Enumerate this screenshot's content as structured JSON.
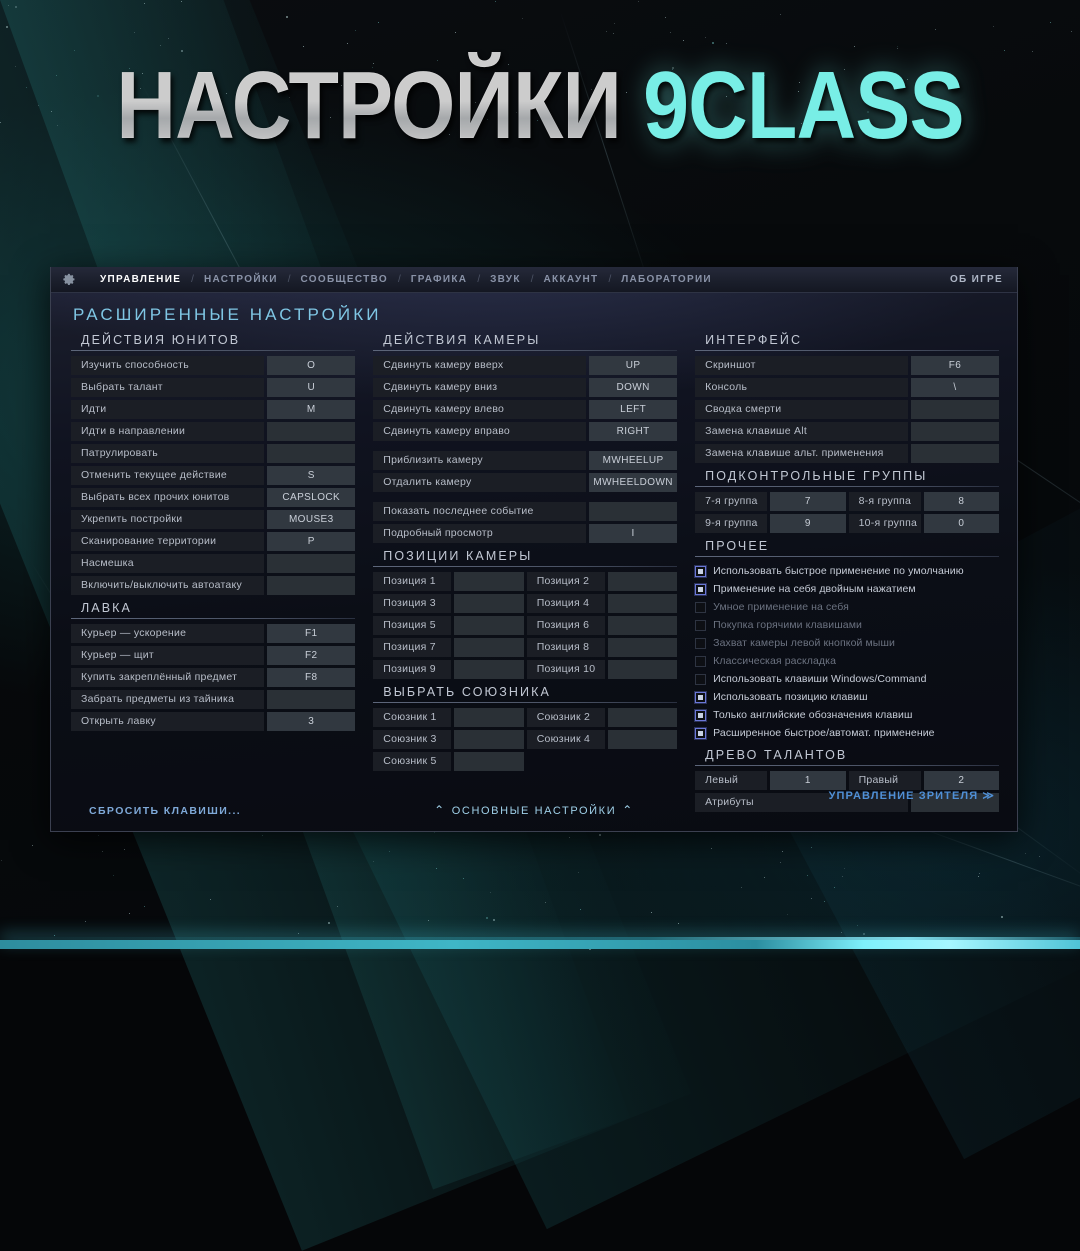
{
  "hero": {
    "title_white": "НАСТРОЙКИ",
    "title_cyan": "9CLASS",
    "cyan": "#78eee6"
  },
  "tabs": {
    "gear_icon": "gear-icon",
    "items": [
      {
        "label": "УПРАВЛЕНИЕ",
        "active": true
      },
      {
        "label": "НАСТРОЙКИ",
        "active": false
      },
      {
        "label": "СООБЩЕСТВО",
        "active": false
      },
      {
        "label": "ГРАФИКА",
        "active": false
      },
      {
        "label": "ЗВУК",
        "active": false
      },
      {
        "label": "АККАУНТ",
        "active": false
      },
      {
        "label": "ЛАБОРАТОРИИ",
        "active": false
      }
    ],
    "separator": "/",
    "right_item": "ОБ ИГРЕ"
  },
  "page_title": "РАСШИРЕННЫЕ НАСТРОЙКИ",
  "columns": {
    "unit_actions": {
      "heading": "ДЕЙСТВИЯ ЮНИТОВ",
      "rows": [
        {
          "label": "Изучить способность",
          "key": "O"
        },
        {
          "label": "Выбрать талант",
          "key": "U"
        },
        {
          "label": "Идти",
          "key": "M"
        },
        {
          "label": "Идти в направлении",
          "key": ""
        },
        {
          "label": "Патрулировать",
          "key": ""
        },
        {
          "label": "Отменить текущее действие",
          "key": "S"
        },
        {
          "label": "Выбрать всех прочих юнитов",
          "key": "CAPSLOCK"
        },
        {
          "label": "Укрепить постройки",
          "key": "MOUSE3"
        },
        {
          "label": "Сканирование территории",
          "key": "P"
        },
        {
          "label": "Насмешка",
          "key": ""
        },
        {
          "label": "Включить/выключить автоатаку",
          "key": ""
        }
      ]
    },
    "shop": {
      "heading": "ЛАВКА",
      "rows": [
        {
          "label": "Курьер — ускорение",
          "key": "F1"
        },
        {
          "label": "Курьер — щит",
          "key": "F2"
        },
        {
          "label": "Купить закреплённый предмет",
          "key": "F8"
        },
        {
          "label": "Забрать предметы из тайника",
          "key": ""
        },
        {
          "label": "Открыть лавку",
          "key": "3"
        }
      ]
    },
    "camera_actions": {
      "heading": "ДЕЙСТВИЯ КАМЕРЫ",
      "rows": [
        {
          "label": "Сдвинуть камеру вверх",
          "key": "UP"
        },
        {
          "label": "Сдвинуть камеру вниз",
          "key": "DOWN"
        },
        {
          "label": "Сдвинуть камеру влево",
          "key": "LEFT"
        },
        {
          "label": "Сдвинуть камеру вправо",
          "key": "RIGHT"
        }
      ],
      "rows2": [
        {
          "label": "Приблизить камеру",
          "key": "MWHEELUP"
        },
        {
          "label": "Отдалить камеру",
          "key": "MWHEELDOWN"
        }
      ],
      "rows3": [
        {
          "label": "Показать последнее событие",
          "key": ""
        },
        {
          "label": "Подробный просмотр",
          "key": "I"
        }
      ]
    },
    "camera_positions": {
      "heading": "ПОЗИЦИИ КАМЕРЫ",
      "rows": [
        [
          {
            "label": "Позиция 1",
            "key": ""
          },
          {
            "label": "Позиция 2",
            "key": ""
          }
        ],
        [
          {
            "label": "Позиция 3",
            "key": ""
          },
          {
            "label": "Позиция 4",
            "key": ""
          }
        ],
        [
          {
            "label": "Позиция 5",
            "key": ""
          },
          {
            "label": "Позиция 6",
            "key": ""
          }
        ],
        [
          {
            "label": "Позиция 7",
            "key": ""
          },
          {
            "label": "Позиция 8",
            "key": ""
          }
        ],
        [
          {
            "label": "Позиция 9",
            "key": ""
          },
          {
            "label": "Позиция 10",
            "key": ""
          }
        ]
      ]
    },
    "select_ally": {
      "heading": "ВЫБРАТЬ СОЮЗНИКА",
      "rows": [
        [
          {
            "label": "Союзник 1",
            "key": ""
          },
          {
            "label": "Союзник 2",
            "key": ""
          }
        ],
        [
          {
            "label": "Союзник 3",
            "key": ""
          },
          {
            "label": "Союзник 4",
            "key": ""
          }
        ],
        [
          {
            "label": "Союзник 5",
            "key": ""
          },
          {
            "label": "",
            "key": ""
          }
        ]
      ]
    },
    "interface": {
      "heading": "ИНТЕРФЕЙС",
      "rows": [
        {
          "label": "Скриншот",
          "key": "F6"
        },
        {
          "label": "Консоль",
          "key": "\\"
        },
        {
          "label": "Сводка смерти",
          "key": ""
        },
        {
          "label": "Замена клавише Alt",
          "key": ""
        },
        {
          "label": "Замена клавише альт. применения",
          "key": ""
        }
      ]
    },
    "control_groups": {
      "heading": "ПОДКОНТРОЛЬНЫЕ ГРУППЫ",
      "rows": [
        [
          {
            "label": "7-я группа",
            "key": "7"
          },
          {
            "label": "8-я группа",
            "key": "8"
          }
        ],
        [
          {
            "label": "9-я группа",
            "key": "9"
          },
          {
            "label": "10-я группа",
            "key": "0"
          }
        ]
      ]
    },
    "other": {
      "heading": "ПРОЧЕЕ",
      "checkboxes": [
        {
          "label": "Использовать быстрое применение по умолчанию",
          "checked": true,
          "dim": false
        },
        {
          "label": "Применение на себя двойным нажатием",
          "checked": true,
          "dim": false
        },
        {
          "label": "Умное применение на себя",
          "checked": false,
          "dim": true
        },
        {
          "label": "Покупка горячими клавишами",
          "checked": false,
          "dim": true
        },
        {
          "label": "Захват камеры левой кнопкой мыши",
          "checked": false,
          "dim": true
        },
        {
          "label": "Классическая раскладка",
          "checked": false,
          "dim": true
        },
        {
          "label": "Использовать клавиши Windows/Command",
          "checked": false,
          "dim": false
        },
        {
          "label": "Использовать позицию клавиш",
          "checked": true,
          "dim": false
        },
        {
          "label": "Только английские обозначения клавиш",
          "checked": true,
          "dim": false
        },
        {
          "label": "Расширенное быстрое/автомат. применение",
          "checked": true,
          "dim": false
        }
      ]
    },
    "talent_tree": {
      "heading": "ДРЕВО ТАЛАНТОВ",
      "rows": [
        [
          {
            "label": "Левый",
            "key": "1"
          },
          {
            "label": "Правый",
            "key": "2"
          }
        ]
      ],
      "attributes_label": "Атрибуты",
      "attributes_key": ""
    }
  },
  "footer": {
    "reset_label": "СБРОСИТЬ КЛАВИШИ...",
    "basic_label": "ОСНОВНЫЕ НАСТРОЙКИ",
    "chevron": "⌃",
    "spectator_label": "УПРАВЛЕНИЕ ЗРИТЕЛЯ ≫"
  }
}
